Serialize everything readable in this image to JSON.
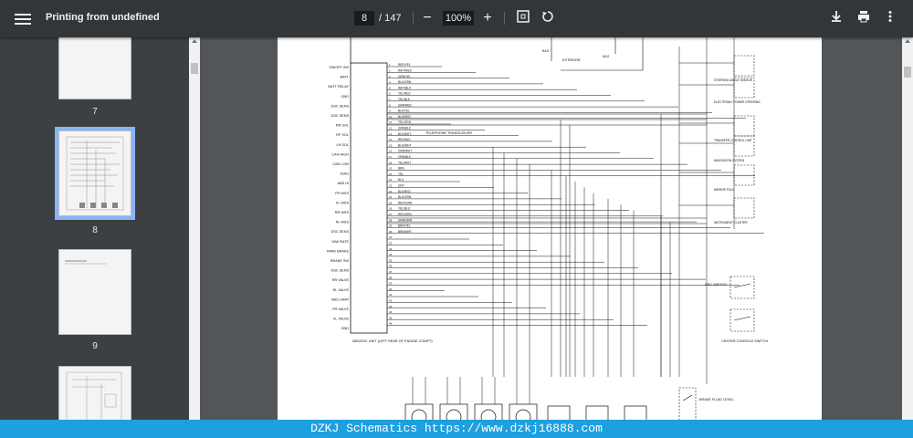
{
  "toolbar": {
    "title": "Printing from undefined",
    "current_page": "8",
    "total_pages": "/ 147",
    "zoom": "100%"
  },
  "thumbnails": [
    {
      "label": "7",
      "active": false
    },
    {
      "label": "8",
      "active": true
    },
    {
      "label": "9",
      "active": false
    }
  ],
  "page": {
    "left_labels": [
      "ON/OFF SW",
      "BATT",
      "BATT RELAY",
      "GND",
      "DSC SENS",
      "DSC SENS",
      "RR SOL",
      "RF SOL",
      "LR SOL",
      "CAN HIGH",
      "CAN LOW",
      "DIAG",
      "ABS HI",
      "FR WSS",
      "FL WSS",
      "RR WSS",
      "RL WSS",
      "DSC SENS",
      "YAW RATE",
      "PARK BRAKE",
      "BRAKE SW",
      "DSC SENS",
      "RR VALVE",
      "RL VALVE",
      "ABS LAMP",
      "FR VALVE",
      "FL VALVE",
      "GND"
    ],
    "wire_labels": [
      "RED/YEL",
      "WHT/RED",
      "GRN/YEL",
      "BLU/ORN",
      "WHT/BLK",
      "YEL/RED",
      "YEL/BLK",
      "GRN/RED",
      "BLK/YEL",
      "BLU/RED",
      "YEL/GRN",
      "GRN/BLK",
      "BLK/WHT",
      "RED/BLK",
      "BLU/WHT",
      "GRN/WHT",
      "ORN/BLK",
      "YEL/WHT",
      "BRN",
      "YEL",
      "BLU",
      "GRY",
      "BLK/RED",
      "BLU/GRN",
      "WHT/GRN",
      "YEL/BLU",
      "RED/GRN",
      "GRN/ORN",
      "BRN/YEL",
      "BRN/WHT"
    ],
    "right_components": [
      {
        "name": "STEERING ANGLE SENSOR"
      },
      {
        "name": "ELECTRONIC POWER STEERING"
      },
      {
        "name": "TRANSFER CONTROL UNIT"
      },
      {
        "name": "NAVIGATION SYSTEM"
      },
      {
        "name": "MIRROR FOLD"
      },
      {
        "name": "INSTRUMENT CLUSTER"
      }
    ],
    "switch_labels": [
      "DSC SWITCH",
      "BRAKE FLUID LEVEL",
      "CENTER CONSOLE SWITCH"
    ],
    "splice_text": "TELEPHONE TRANSCEIVER",
    "bottom_note": "ABS/DSC UNIT (LEFT REAR OF ENGINE COMPT)"
  },
  "watermark": "DZKJ Schematics https://www.dzkj16888.com"
}
